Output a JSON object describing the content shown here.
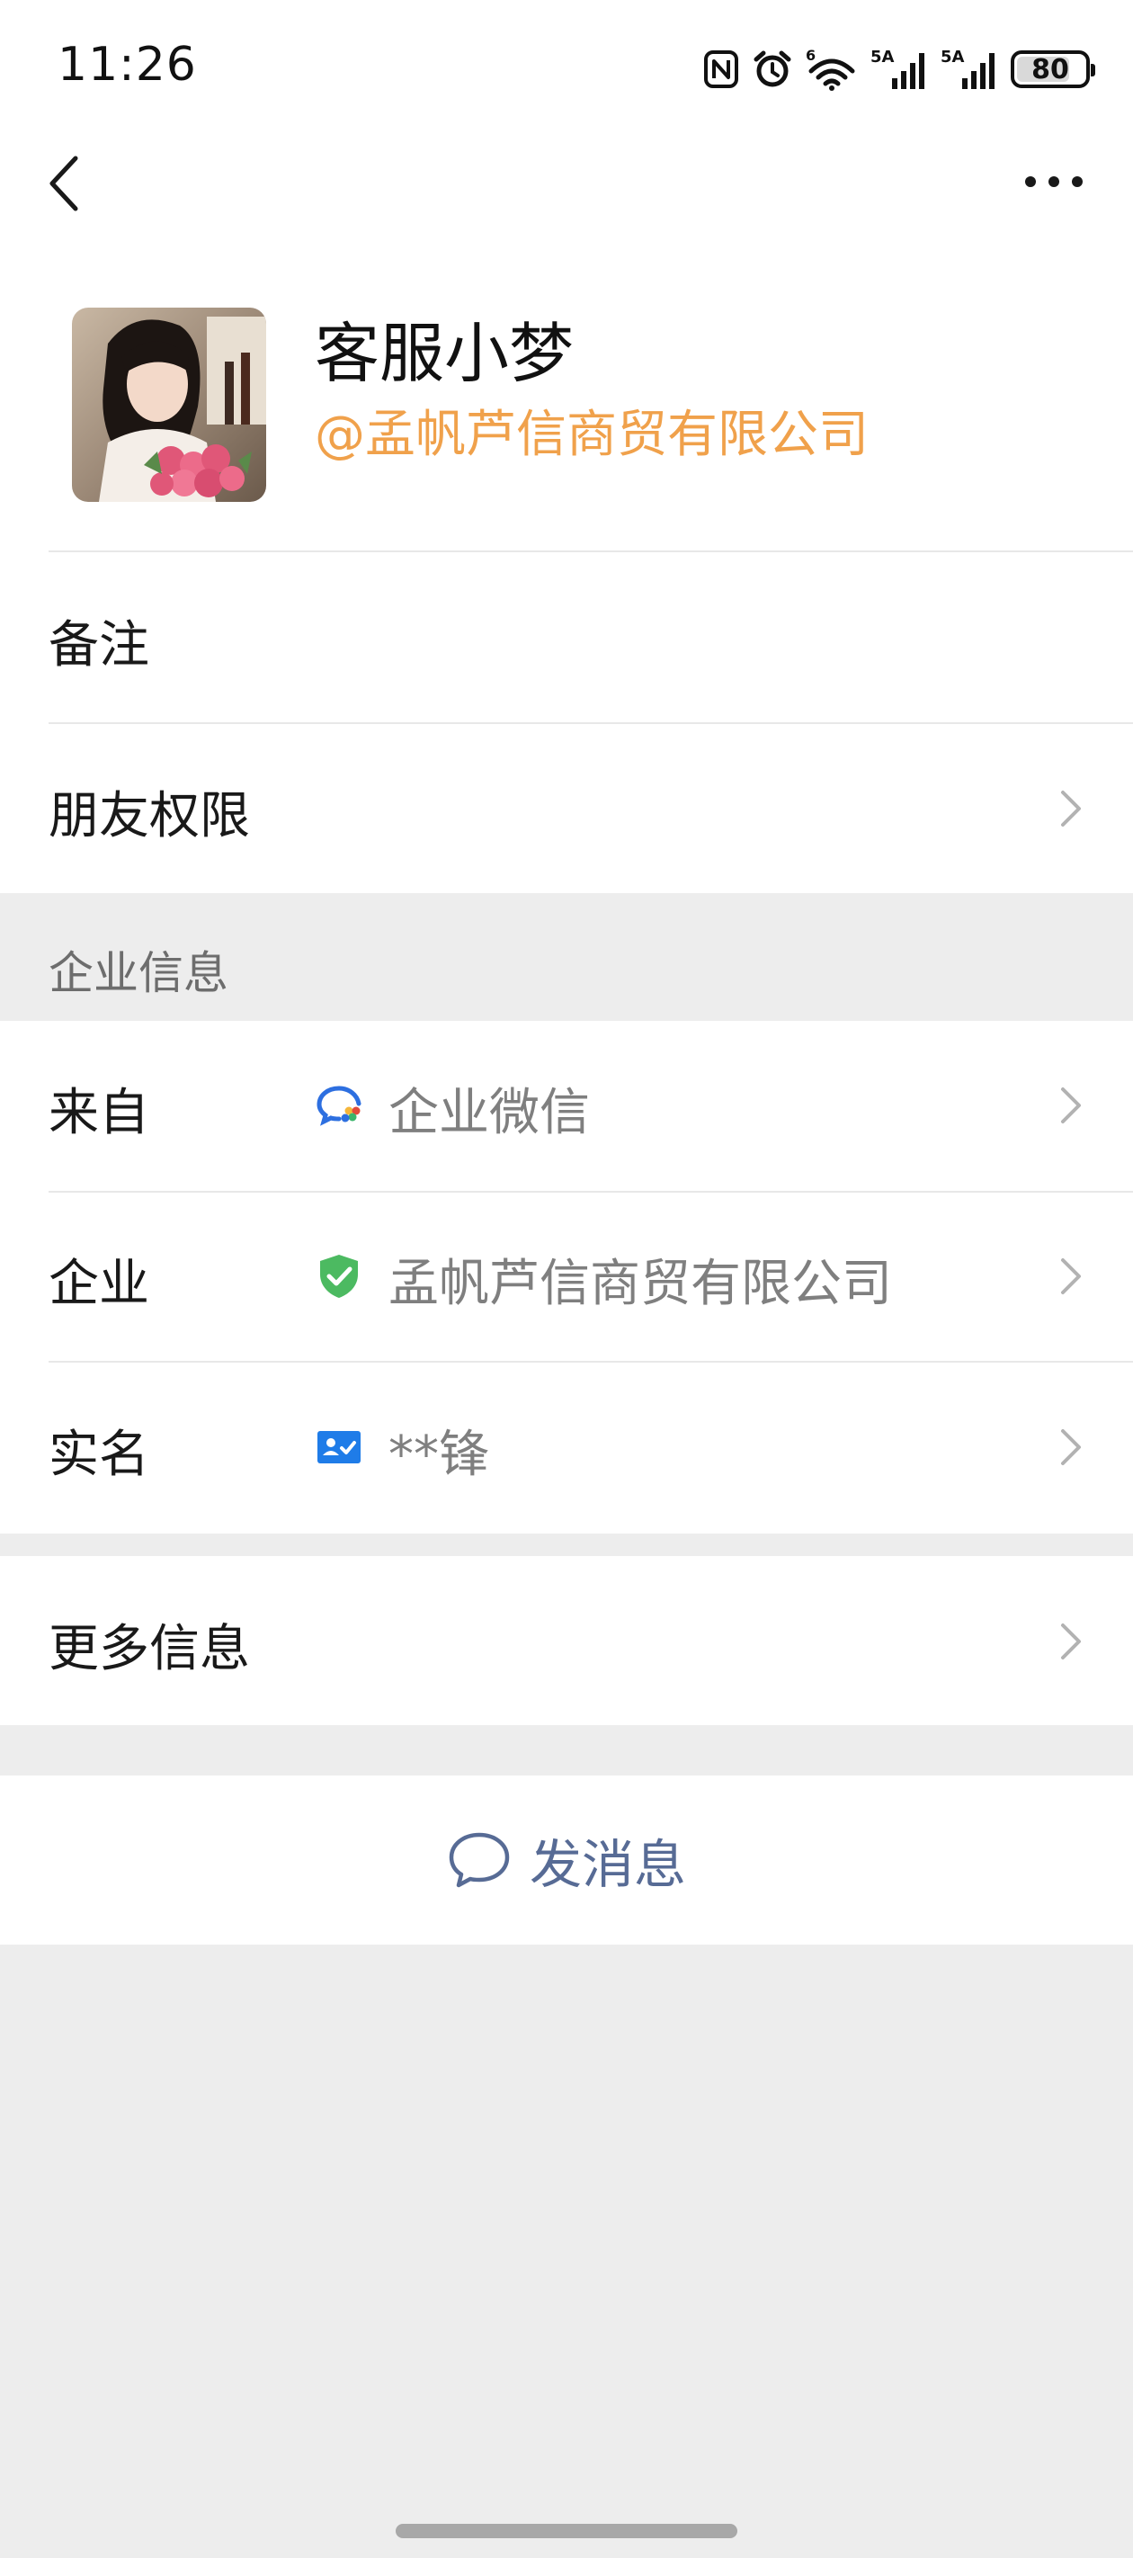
{
  "status_bar": {
    "time": "11:26",
    "battery": "80",
    "battery_level": 0.8,
    "signal_labels": [
      "5A",
      "5A"
    ],
    "wifi_label": "6"
  },
  "profile": {
    "name": "客服小梦",
    "company_tag": "@孟帆芦信商贸有限公司"
  },
  "rows": {
    "remark": "备注",
    "friend_permission": "朋友权限"
  },
  "enterprise": {
    "section_title": "企业信息",
    "from_label": "来自",
    "from_value": "企业微信",
    "company_label": "企业",
    "company_value": "孟帆芦信商贸有限公司",
    "realname_label": "实名",
    "realname_value": "**锋"
  },
  "more_info": "更多信息",
  "send_message": "发消息",
  "colors": {
    "accent_orange": "#f0a14b",
    "link_blue": "#576b95",
    "verify_green": "#4cba61",
    "id_blue": "#1f7ce8",
    "background": "#ededed"
  },
  "icons": {
    "back": "chevron-left-icon",
    "more": "more-dots-icon",
    "nfc": "nfc-icon",
    "alarm": "alarm-icon",
    "wifi": "wifi-icon",
    "signal": "signal-icon",
    "enterprise_wechat": "wecom-logo-icon",
    "verified": "shield-check-icon",
    "realname": "id-card-icon",
    "chevron": "chevron-right-icon",
    "message": "chat-bubble-icon"
  }
}
